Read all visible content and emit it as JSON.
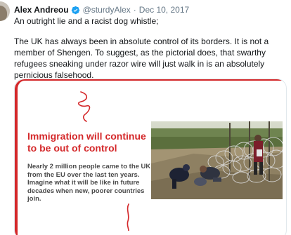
{
  "tweet": {
    "author_name": "Alex Andreou",
    "handle": "@sturdyAlex",
    "separator": "·",
    "date": "Dec 10, 2017",
    "text_line1": "An outright lie and a racist dog whistle;",
    "text_paragraph2": "The UK has always been in absolute control of its borders. It is not a member of Shengen. To suggest, as the pictorial does, that swarthy refugees sneaking under razor wire will just walk in is an absolutely pernicious falsehood."
  },
  "flyer": {
    "headline": "Immigration will continue to be out of control",
    "body": "Nearly 2 million people came to the UK from the EU over the last ten years. Imagine what it will be like in future decades when new, poorer countries join.",
    "accent_color": "#d4282a"
  },
  "icons": {
    "verified": "verified-badge-icon"
  }
}
